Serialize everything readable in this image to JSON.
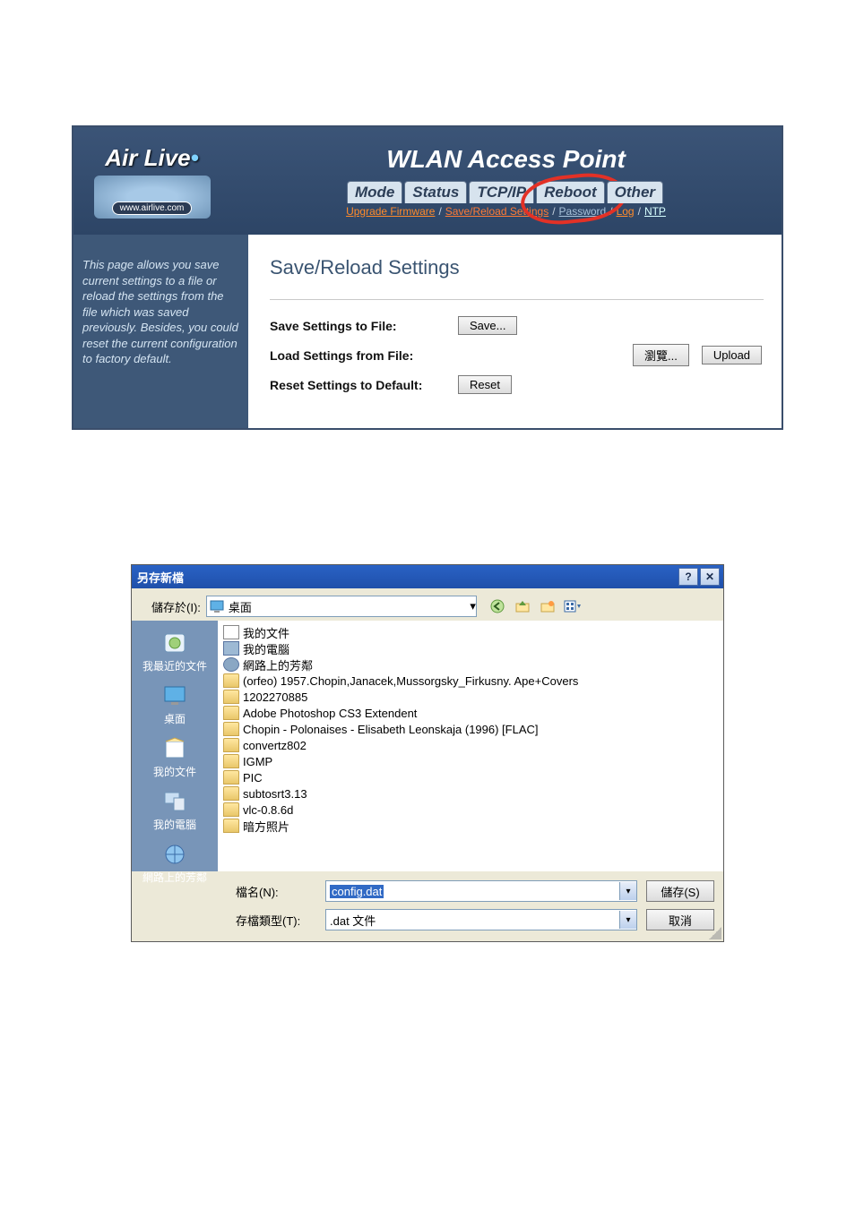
{
  "router": {
    "brand": "Air Live",
    "brand_url": "www.airlive.com",
    "title": "WLAN Access Point",
    "tabs": {
      "mode": "Mode",
      "status": "Status",
      "tcpip": "TCP/IP",
      "reboot": "Reboot",
      "other": "Other"
    },
    "subtabs": {
      "upgrade": "Upgrade Firmware",
      "savereload": "Save/Reload Settings",
      "password": "Password",
      "log": "Log",
      "ntp": "NTP"
    },
    "page_heading": "Save/Reload Settings",
    "side_help": "This page allows you save current settings to a file or reload the settings from the file which was saved previously. Besides, you could reset the current configuration to factory default.",
    "rows": {
      "save_label": "Save Settings to File:",
      "save_btn": "Save...",
      "load_label": "Load Settings from File:",
      "browse_btn": "瀏覽...",
      "upload_btn": "Upload",
      "reset_label": "Reset Settings to Default:",
      "reset_btn": "Reset"
    }
  },
  "dialog": {
    "title": "另存新檔",
    "titlebar_btns": {
      "help": "?",
      "close": "✕"
    },
    "savein_label": "儲存於(I):",
    "savein_value": "桌面",
    "sidebar": [
      {
        "name": "recent",
        "label": "我最近的文件"
      },
      {
        "name": "desktop",
        "label": "桌面"
      },
      {
        "name": "mydocs",
        "label": "我的文件"
      },
      {
        "name": "mycomputer",
        "label": "我的電腦"
      },
      {
        "name": "network",
        "label": "網路上的芳鄰"
      }
    ],
    "files": [
      {
        "icon": "file",
        "label": "我的文件"
      },
      {
        "icon": "pc",
        "label": "我的電腦"
      },
      {
        "icon": "net",
        "label": "網路上的芳鄰"
      },
      {
        "icon": "folder",
        "label": "(orfeo) 1957.Chopin,Janacek,Mussorgsky_Firkusny. Ape+Covers"
      },
      {
        "icon": "folder",
        "label": "1202270885"
      },
      {
        "icon": "folder",
        "label": "Adobe Photoshop CS3 Extendent"
      },
      {
        "icon": "folder",
        "label": "Chopin - Polonaises - Elisabeth Leonskaja (1996) [FLAC]"
      },
      {
        "icon": "folder",
        "label": "convertz802"
      },
      {
        "icon": "folder",
        "label": "IGMP"
      },
      {
        "icon": "folder",
        "label": "PIC"
      },
      {
        "icon": "folder",
        "label": "subtosrt3.13"
      },
      {
        "icon": "folder",
        "label": "vlc-0.8.6d"
      },
      {
        "icon": "folder",
        "label": "暗方照片"
      }
    ],
    "filename_label": "檔名(N):",
    "filename_value": "config.dat",
    "filetype_label": "存檔類型(T):",
    "filetype_value": ".dat 文件",
    "save_btn": "儲存(S)",
    "cancel_btn": "取消"
  }
}
